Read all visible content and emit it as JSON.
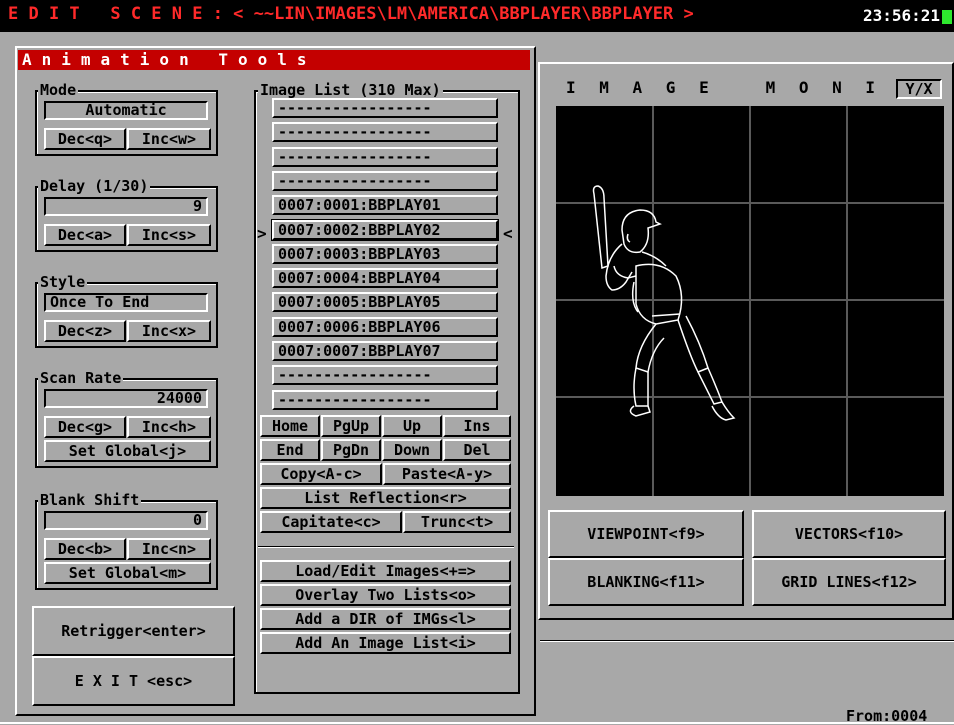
{
  "titlebar": {
    "title": "E D I T   S C E N E : < ~~LIN\\IMAGES\\LM\\AMERICA\\BBPLAYER\\BBPLAYER >",
    "clock": "23:56:21"
  },
  "tools": {
    "header": "Animation Tools",
    "mode": {
      "label": "Mode",
      "value": "Automatic",
      "dec": "Dec<q>",
      "inc": "Inc<w>"
    },
    "delay": {
      "label": "Delay (1/30)",
      "value": "9",
      "dec": "Dec<a>",
      "inc": "Inc<s>"
    },
    "style": {
      "label": "Style",
      "value": "Once To End",
      "dec": "Dec<z>",
      "inc": "Inc<x>"
    },
    "scan_rate": {
      "label": "Scan Rate",
      "value": "24000",
      "dec": "Dec<g>",
      "inc": "Inc<h>",
      "global": "Set Global<j>"
    },
    "blank_shift": {
      "label": "Blank Shift",
      "value": "0",
      "dec": "Dec<b>",
      "inc": "Inc<n>",
      "global": "Set Global<m>"
    },
    "retrigger": "Retrigger<enter>",
    "exit": "E X I T <esc>"
  },
  "image_list": {
    "label": "Image List (310 Max)",
    "rows": [
      "-----------------",
      "-----------------",
      "-----------------",
      "-----------------",
      "0007:0001:BBPLAY01",
      "0007:0002:BBPLAY02",
      "0007:0003:BBPLAY03",
      "0007:0004:BBPLAY04",
      "0007:0005:BBPLAY05",
      "0007:0006:BBPLAY06",
      "0007:0007:BBPLAY07",
      "-----------------",
      "-----------------"
    ],
    "selected_marker_left": ">",
    "selected_marker_right": "<",
    "nav": [
      "Home",
      "PgUp",
      "Up",
      "Ins",
      "End",
      "PgDn",
      "Down",
      "Del"
    ],
    "copy": "Copy<A-c>",
    "paste": "Paste<A-y>",
    "reflection": "List Reflection<r>",
    "capitate": "Capitate<c>",
    "trunc": "Trunc<t>",
    "load_edit": "Load/Edit Images<+=>",
    "overlay": "Overlay Two Lists<o>",
    "add_dir": "Add a DIR of IMGs<l>",
    "add_list": "Add An Image List<i>"
  },
  "monitor": {
    "title": "I M A G E   M O N I T O R:",
    "axis": "Y/X",
    "viewpoint": "VIEWPOINT<f9>",
    "vectors": "VECTORS<f10>",
    "blanking": "BLANKING<f11>",
    "grid_lines": "GRID LINES<f12>"
  },
  "status": {
    "from": "From:0004"
  }
}
